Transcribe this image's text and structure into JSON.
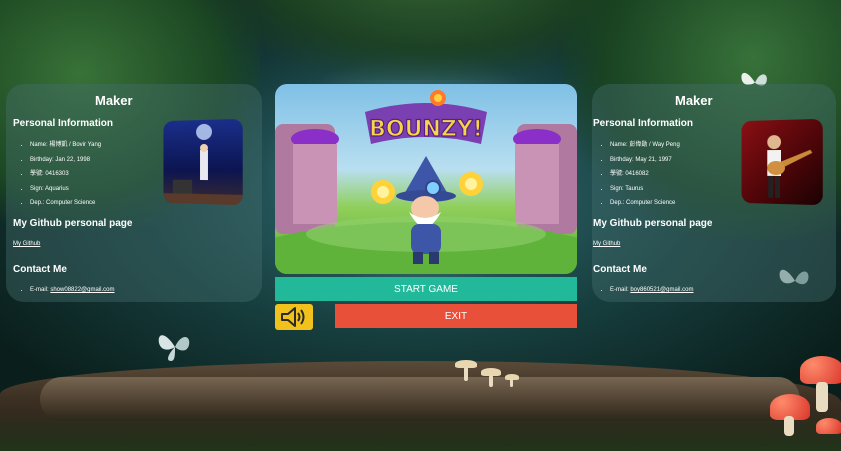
{
  "left_panel": {
    "title": "Maker",
    "personal_heading": "Personal Information",
    "personal_items": [
      "Name: 楊博凱 / Bovir Yang",
      "Birthday: Jan 22, 1998",
      "學號: 0416303",
      "Sign: Aquarius",
      "Dep.: Computer Science"
    ],
    "github_heading": "My Github personal page",
    "github_link": "My Github",
    "contact_heading": "Contact Me",
    "email_label": "E-mail:",
    "email": "show08822@gmail.com",
    "photo_icon": "performer-on-stage-photo"
  },
  "right_panel": {
    "title": "Maker",
    "personal_heading": "Personal Information",
    "personal_items": [
      "Name: 彭偉勛 / Way Peng",
      "Birthday: May 21, 1997",
      "學號: 0416082",
      "Sign: Taurus",
      "Dep.: Computer Science"
    ],
    "github_heading": "My Github personal page",
    "github_link": "My Github",
    "contact_heading": "Contact Me",
    "email_label": "E-mail:",
    "email": "boy860521@gmail.com",
    "photo_icon": "guitarist-photo"
  },
  "game": {
    "logo": "BOUNZY!",
    "banner_icon": "wizard-with-fire-orbs-artwork",
    "start_label": "START GAME",
    "exit_label": "EXIT",
    "sound_icon": "speaker-sound-on-icon"
  },
  "colors": {
    "start": "#22b89a",
    "exit": "#e9503a",
    "sound": "#f2c21c",
    "panel": "rgba(70,110,110,0.42)"
  }
}
